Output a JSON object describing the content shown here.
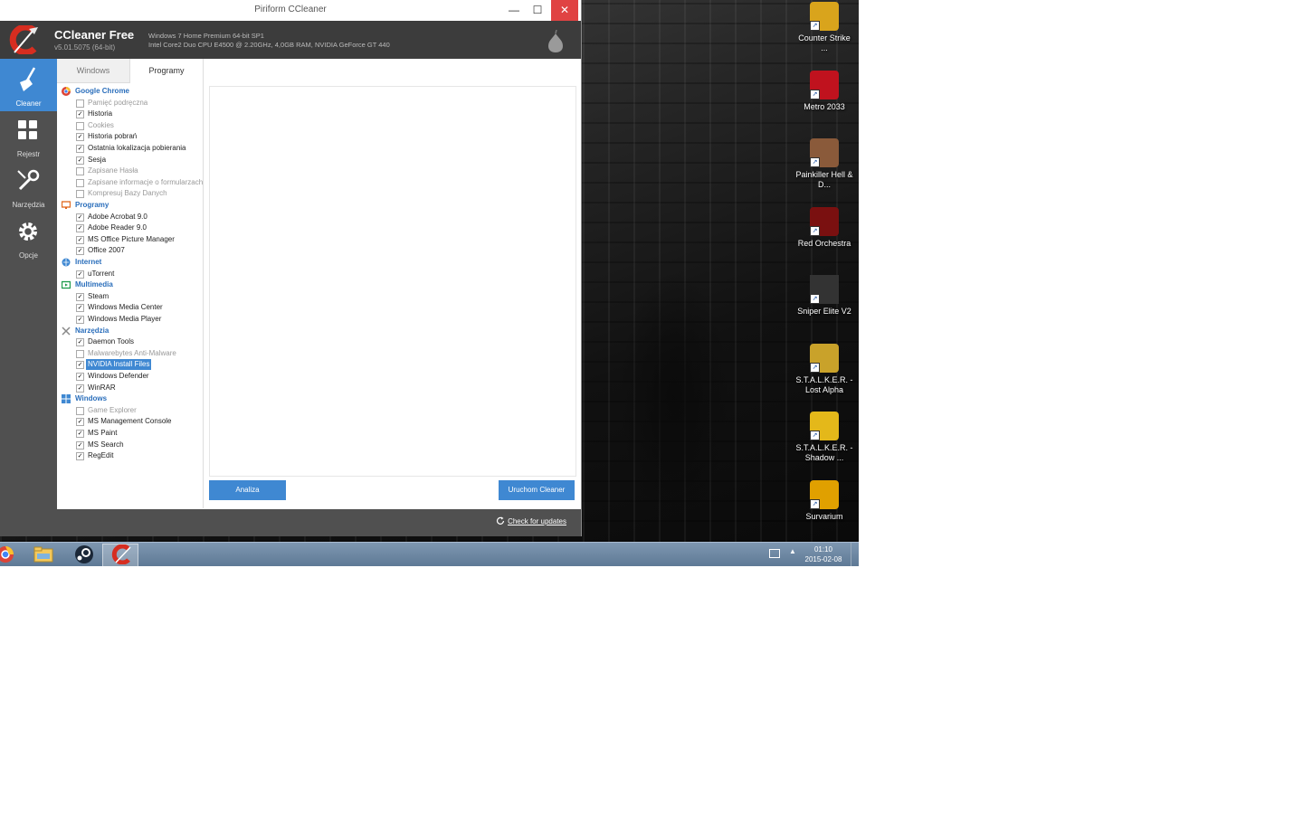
{
  "window": {
    "title": "Piriform CCleaner",
    "controls": {
      "minimize": "—",
      "maximize": "☐",
      "close": "✕"
    }
  },
  "header": {
    "app_name": "CCleaner Free",
    "version": "v5.01.5075 (64-bit)",
    "sys_line1": "Windows 7 Home Premium 64-bit SP1",
    "sys_line2": "Intel Core2 Duo CPU E4500 @ 2.20GHz, 4,0GB RAM, NVIDIA GeForce GT 440"
  },
  "nav": [
    {
      "label": "Cleaner",
      "icon": "broom-icon",
      "active": true
    },
    {
      "label": "Rejestr",
      "icon": "registry-icon",
      "active": false
    },
    {
      "label": "Narzędzia",
      "icon": "wrench-icon",
      "active": false
    },
    {
      "label": "Opcje",
      "icon": "gear-icon",
      "active": false
    }
  ],
  "tabs": {
    "windows": "Windows",
    "programy": "Programy"
  },
  "tree": {
    "chrome": {
      "label": "Google Chrome",
      "icon": "chrome-icon",
      "color": "#2a6ebb",
      "items": [
        {
          "label": "Pamięć podręczna",
          "checked": false
        },
        {
          "label": "Historia",
          "checked": true
        },
        {
          "label": "Cookies",
          "checked": false
        },
        {
          "label": "Historia pobrań",
          "checked": true
        },
        {
          "label": "Ostatnia lokalizacja pobierania",
          "checked": true
        },
        {
          "label": "Sesja",
          "checked": true
        },
        {
          "label": "Zapisane Hasła",
          "checked": false
        },
        {
          "label": "Zapisane informacje o formularzach",
          "checked": false
        },
        {
          "label": "Kompresuj Bazy Danych",
          "checked": false
        }
      ]
    },
    "programy": {
      "label": "Programy",
      "icon": "monitor-icon",
      "items": [
        {
          "label": "Adobe Acrobat 9.0",
          "checked": true
        },
        {
          "label": "Adobe Reader 9.0",
          "checked": true
        },
        {
          "label": "MS Office Picture Manager",
          "checked": true
        },
        {
          "label": "Office 2007",
          "checked": true
        }
      ]
    },
    "internet": {
      "label": "Internet",
      "icon": "globe-icon",
      "items": [
        {
          "label": "uTorrent",
          "checked": true
        }
      ]
    },
    "multimedia": {
      "label": "Multimedia",
      "icon": "media-icon",
      "items": [
        {
          "label": "Steam",
          "checked": true
        },
        {
          "label": "Windows Media Center",
          "checked": true
        },
        {
          "label": "Windows Media Player",
          "checked": true
        }
      ]
    },
    "narzedzia": {
      "label": "Narzędzia",
      "icon": "tools-icon",
      "items": [
        {
          "label": "Daemon Tools",
          "checked": true
        },
        {
          "label": "Malwarebytes Anti-Malware",
          "checked": false
        },
        {
          "label": "NVIDIA Install Files",
          "checked": true,
          "selected": true
        },
        {
          "label": "Windows Defender",
          "checked": true
        },
        {
          "label": "WinRAR",
          "checked": true
        }
      ]
    },
    "windows": {
      "label": "Windows",
      "icon": "windows-icon",
      "items": [
        {
          "label": "Game Explorer",
          "checked": false
        },
        {
          "label": "MS Management Console",
          "checked": true
        },
        {
          "label": "MS Paint",
          "checked": true
        },
        {
          "label": "MS Search",
          "checked": true
        },
        {
          "label": "RegEdit",
          "checked": true
        }
      ]
    }
  },
  "buttons": {
    "analyze": "Analiza",
    "run": "Uruchom Cleaner"
  },
  "footer": {
    "check_updates": "Check for updates"
  },
  "desktop_icons": [
    {
      "label": "Counter Strike ...",
      "icon": "csgo-icon",
      "color": "#d9a41c"
    },
    {
      "label": "Metro 2033",
      "icon": "metro-icon",
      "color": "#c0121e"
    },
    {
      "label": "Painkiller Hell & D...",
      "icon": "painkiller-icon",
      "color": "#8a5a3a"
    },
    {
      "label": "Red Orchestra",
      "icon": "red-orchestra-icon",
      "color": "#7a1010"
    },
    {
      "label": "Sniper Elite V2",
      "icon": "sniper-elite-icon",
      "color": "#333"
    },
    {
      "label": "S.T.A.L.K.E.R. - Lost Alpha",
      "icon": "stalker-lost-alpha-icon",
      "color": "#c9a22a"
    },
    {
      "label": "S.T.A.L.K.E.R. - Shadow ...",
      "icon": "stalker-shadow-icon",
      "color": "#e4b81a"
    },
    {
      "label": "Survarium",
      "icon": "survarium-icon",
      "color": "#e0a000"
    }
  ],
  "taskbar": {
    "items": [
      "chrome-icon",
      "explorer-icon",
      "steam-icon",
      "ccleaner-icon"
    ],
    "time": "01:10",
    "date": "2015-02-08"
  }
}
